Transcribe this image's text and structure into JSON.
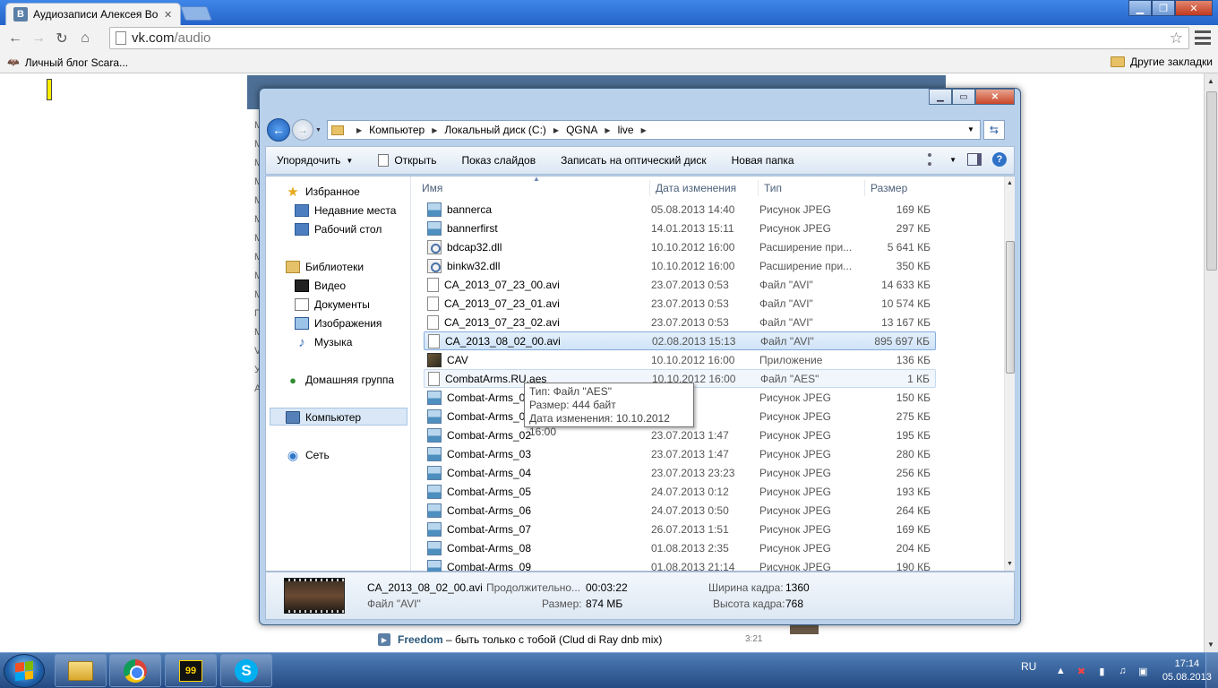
{
  "browser": {
    "tab_title": "Аудиозаписи Алексея Во",
    "url_host": "vk.com",
    "url_path": "/audio",
    "bookmarks": [
      {
        "label": "Личный блог Scara..."
      }
    ],
    "other_bookmarks": "Другие закладки"
  },
  "vk_page": {
    "left_letters": [
      "M",
      "M",
      "M",
      "M",
      "M",
      "M",
      "M",
      "M",
      "M",
      "M",
      "П",
      "M",
      "V",
      "У",
      "A"
    ],
    "track": {
      "artist": "Freedom",
      "title": " – быть только с тобой (Clud di Ray dnb mix)",
      "duration": "3:21"
    }
  },
  "explorer": {
    "breadcrumb": [
      "Компьютер",
      "Локальный диск (C:)",
      "QGNA",
      "live"
    ],
    "commands": {
      "organize": "Упорядочить",
      "open": "Открыть",
      "slideshow": "Показ слайдов",
      "burn": "Записать на оптический диск",
      "new_folder": "Новая папка"
    },
    "nav": {
      "favorites": "Избранное",
      "recent": "Недавние места",
      "desktop": "Рабочий стол",
      "libraries": "Библиотеки",
      "video": "Видео",
      "documents": "Документы",
      "images": "Изображения",
      "music": "Музыка",
      "homegroup": "Домашняя группа",
      "computer": "Компьютер",
      "network": "Сеть"
    },
    "columns": {
      "name": "Имя",
      "date": "Дата изменения",
      "type": "Тип",
      "size": "Размер"
    },
    "files": [
      {
        "name": "bannerca",
        "date": "05.08.2013 14:40",
        "type": "Рисунок JPEG",
        "size": "169 КБ",
        "icon": "jpeg"
      },
      {
        "name": "bannerfirst",
        "date": "14.01.2013 15:11",
        "type": "Рисунок JPEG",
        "size": "297 КБ",
        "icon": "jpeg"
      },
      {
        "name": "bdcap32.dll",
        "date": "10.10.2012 16:00",
        "type": "Расширение при...",
        "size": "5 641 КБ",
        "icon": "dll"
      },
      {
        "name": "binkw32.dll",
        "date": "10.10.2012 16:00",
        "type": "Расширение при...",
        "size": "350 КБ",
        "icon": "dll"
      },
      {
        "name": "CA_2013_07_23_00.avi",
        "date": "23.07.2013 0:53",
        "type": "Файл \"AVI\"",
        "size": "14 633 КБ",
        "icon": "file"
      },
      {
        "name": "CA_2013_07_23_01.avi",
        "date": "23.07.2013 0:53",
        "type": "Файл \"AVI\"",
        "size": "10 574 КБ",
        "icon": "file"
      },
      {
        "name": "CA_2013_07_23_02.avi",
        "date": "23.07.2013 0:53",
        "type": "Файл \"AVI\"",
        "size": "13 167 КБ",
        "icon": "file"
      },
      {
        "name": "CA_2013_08_02_00.avi",
        "date": "02.08.2013 15:13",
        "type": "Файл \"AVI\"",
        "size": "895 697 КБ",
        "icon": "file"
      },
      {
        "name": "CAV",
        "date": "10.10.2012 16:00",
        "type": "Приложение",
        "size": "136 КБ",
        "icon": "app"
      },
      {
        "name": "CombatArms.RU.aes",
        "date": "10.10.2012 16:00",
        "type": "Файл \"AES\"",
        "size": "1 КБ",
        "icon": "file"
      },
      {
        "name": "Combat-Arms_00",
        "date": "13 23:14",
        "type": "Рисунок JPEG",
        "size": "150 КБ",
        "icon": "jpeg"
      },
      {
        "name": "Combat-Arms_01",
        "date": "13 1:17",
        "type": "Рисунок JPEG",
        "size": "275 КБ",
        "icon": "jpeg"
      },
      {
        "name": "Combat-Arms_02",
        "date": "23.07.2013 1:47",
        "type": "Рисунок JPEG",
        "size": "195 КБ",
        "icon": "jpeg"
      },
      {
        "name": "Combat-Arms_03",
        "date": "23.07.2013 1:47",
        "type": "Рисунок JPEG",
        "size": "280 КБ",
        "icon": "jpeg"
      },
      {
        "name": "Combat-Arms_04",
        "date": "23.07.2013 23:23",
        "type": "Рисунок JPEG",
        "size": "256 КБ",
        "icon": "jpeg"
      },
      {
        "name": "Combat-Arms_05",
        "date": "24.07.2013 0:12",
        "type": "Рисунок JPEG",
        "size": "193 КБ",
        "icon": "jpeg"
      },
      {
        "name": "Combat-Arms_06",
        "date": "24.07.2013 0:50",
        "type": "Рисунок JPEG",
        "size": "264 КБ",
        "icon": "jpeg"
      },
      {
        "name": "Combat-Arms_07",
        "date": "26.07.2013 1:51",
        "type": "Рисунок JPEG",
        "size": "169 КБ",
        "icon": "jpeg"
      },
      {
        "name": "Combat-Arms_08",
        "date": "01.08.2013 2:35",
        "type": "Рисунок JPEG",
        "size": "204 КБ",
        "icon": "jpeg"
      },
      {
        "name": "Combat-Arms_09",
        "date": "01.08.2013 21:14",
        "type": "Рисунок JPEG",
        "size": "190 КБ",
        "icon": "jpeg"
      }
    ],
    "tooltip": {
      "type": "Тип: Файл \"AES\"",
      "size": "Размер: 444 байт",
      "date": "Дата изменения: 10.10.2012 16:00"
    },
    "details": {
      "name": "CA_2013_08_02_00.avi",
      "kind": "Файл \"AVI\"",
      "duration_label": "Продолжительно...",
      "duration_value": "00:03:22",
      "size_label": "Размер:",
      "size_value": "874 МБ",
      "width_label": "Ширина кадра:",
      "width_value": "1360",
      "height_label": "Высота кадра:",
      "height_value": "768"
    }
  },
  "taskbar": {
    "lang": "RU",
    "app99_label": "99",
    "skype_label": "S",
    "time": "17:14",
    "date": "05.08.2013"
  }
}
